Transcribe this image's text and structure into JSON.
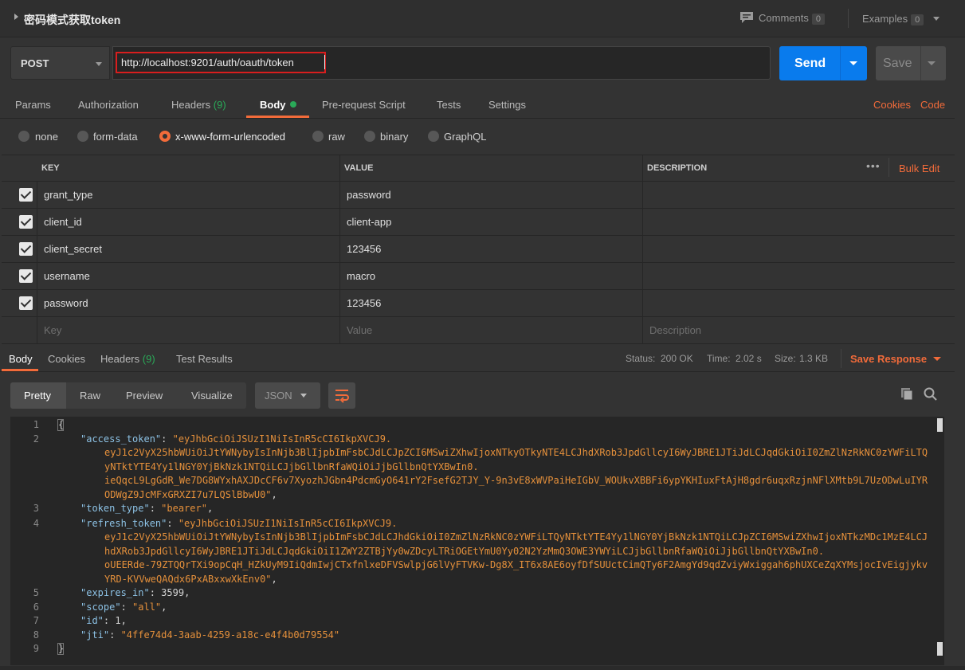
{
  "request": {
    "title": "密码模式获取token"
  },
  "top_actions": {
    "comments_label": "Comments",
    "comments_count": "0",
    "examples_label": "Examples",
    "examples_count": "0"
  },
  "url_bar": {
    "method": "POST",
    "url": "http://localhost:9201/auth/oauth/token",
    "send_label": "Send",
    "save_label": "Save"
  },
  "request_tabs": {
    "params": "Params",
    "authorization": "Authorization",
    "headers": "Headers",
    "headers_count": "(9)",
    "body": "Body",
    "pre_request": "Pre-request Script",
    "tests": "Tests",
    "settings": "Settings",
    "cookies": "Cookies",
    "code": "Code"
  },
  "body_types": {
    "none": "none",
    "form_data": "form-data",
    "urlencoded": "x-www-form-urlencoded",
    "raw": "raw",
    "binary": "binary",
    "graphql": "GraphQL",
    "selected": "x-www-form-urlencoded"
  },
  "table": {
    "headers": {
      "key": "KEY",
      "value": "VALUE",
      "description": "DESCRIPTION"
    },
    "bulk_edit": "Bulk Edit",
    "rows": [
      {
        "key": "grant_type",
        "value": "password",
        "checked": true
      },
      {
        "key": "client_id",
        "value": "client-app",
        "checked": true
      },
      {
        "key": "client_secret",
        "value": "123456",
        "checked": true
      },
      {
        "key": "username",
        "value": "macro",
        "checked": true
      },
      {
        "key": "password",
        "value": "123456",
        "checked": true
      }
    ],
    "placeholders": {
      "key": "Key",
      "value": "Value",
      "description": "Description"
    }
  },
  "response_tabs": {
    "body": "Body",
    "cookies": "Cookies",
    "headers": "Headers",
    "headers_count": "(9)",
    "test_results": "Test Results"
  },
  "response_status": {
    "status_label": "Status:",
    "status": "200 OK",
    "time_label": "Time:",
    "time": "2.02 s",
    "size_label": "Size:",
    "size": "1.3 KB",
    "save_response": "Save Response"
  },
  "view_modes": {
    "pretty": "Pretty",
    "raw": "Raw",
    "preview": "Preview",
    "visualize": "Visualize",
    "format": "JSON"
  },
  "response_lines": {
    "l1": "{",
    "access_key": "\"access_token\"",
    "access_v1": "\"eyJhbGciOiJSUzI1NiIsInR5cCI6IkpXVCJ9.",
    "access_v2": "eyJ1c2VyX25hbWUiOiJtYWNybyIsInNjb3BlIjpbImFsbCJdLCJpZCI6MSwiZXhwIjoxNTkyOTkyNTE4LCJhdXRob3JpdGllcyI6WyJBRE1JTiJdLCJqdGkiOiI0ZmZlNzRkNC0zYWFiLTQ",
    "access_v3": "yNTktYTE4Yy1lNGY0YjBkNzk1NTQiLCJjbGllbnRfaWQiOiJjbGllbnQtYXBwIn0.",
    "access_v4": "ieQqcL9LgGdR_We7DG8WYxhAXJDcCF6v7XyozhJGbn4PdcmGyO641rY2FsefG2TJY_Y-9n3vE8xWVPaiHeIGbV_WOUkvXBBFi6ypYKHIuxFtAjH8gdr6uqxRzjnNFlXMtb9L7UzODwLuIYR",
    "access_v5": "ODWgZ9JcMFxGRXZI7u7LQSlBbwU0\"",
    "token_type_key": "\"token_type\"",
    "token_type_val": "\"bearer\"",
    "refresh_key": "\"refresh_token\"",
    "refresh_v1": "\"eyJhbGciOiJSUzI1NiIsInR5cCI6IkpXVCJ9.",
    "refresh_v2": "eyJ1c2VyX25hbWUiOiJtYWNybyIsInNjb3BlIjpbImFsbCJdLCJhdGkiOiI0ZmZlNzRkNC0zYWFiLTQyNTktYTE4Yy1lNGY0YjBkNzk1NTQiLCJpZCI6MSwiZXhwIjoxNTkzMDc1MzE4LCJ",
    "refresh_v3": "hdXRob3JpdGllcyI6WyJBRE1JTiJdLCJqdGkiOiI1ZWY2ZTBjYy0wZDcyLTRiOGEtYmU0Yy02N2YzMmQ3OWE3YWYiLCJjbGllbnRfaWQiOiJjbGllbnQtYXBwIn0.",
    "refresh_v4": "oUEERde-79ZTQQrTXi9opCqH_HZkUyM9IiQdmIwjCTxfnlxeDFVSwlpjG6lVyFTVKw-Dg8X_IT6x8AE6oyfDfSUUctCimQTy6F2AmgYd9qdZviyWxiggah6phUXCeZqXYMsjocIvEigjykv",
    "refresh_v5": "YRD-KVVweQAQdx6PxABxxwXkEnv0\"",
    "expires_key": "\"expires_in\"",
    "expires_val": "3599",
    "scope_key": "\"scope\"",
    "scope_val": "\"all\"",
    "id_key": "\"id\"",
    "id_val": "1",
    "jti_key": "\"jti\"",
    "jti_val": "\"4ffe74d4-3aab-4259-a18c-e4f4b0d79554\"",
    "l9": "}"
  },
  "line_numbers": [
    "1",
    "2",
    "3",
    "4",
    "5",
    "6",
    "7",
    "8",
    "9"
  ],
  "colors": {
    "accent": "#f26b3a",
    "send": "#097bed",
    "status_ok": "#2aaa58",
    "json_key": "#8cc1e4",
    "json_string": "#e5903b"
  }
}
